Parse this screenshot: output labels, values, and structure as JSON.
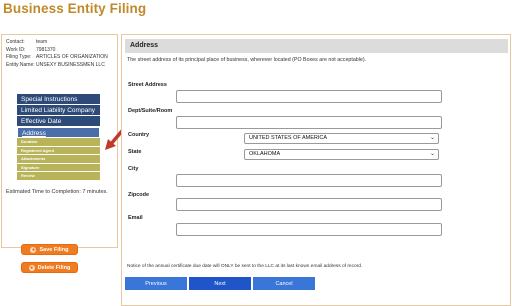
{
  "page": {
    "title": "Business Entity Filing"
  },
  "info": [
    {
      "label": "Contact:",
      "value": "team"
    },
    {
      "label": "Work ID:",
      "value": "7981370"
    },
    {
      "label": "Filing Type:",
      "value": "ARTICLES OF ORGANIZATION"
    },
    {
      "label": "Entity Name:",
      "value": "UNSEXY BUSINESSMEN LLC"
    }
  ],
  "nav": {
    "items": [
      {
        "label": "Special Instructions"
      },
      {
        "label": "Limited Liability Company"
      },
      {
        "label": "Effective Date"
      },
      {
        "label": "Address"
      }
    ],
    "sub_items": [
      {
        "label": "Duration"
      },
      {
        "label": "Registered Agent"
      },
      {
        "label": "Attachments"
      },
      {
        "label": "Signature"
      },
      {
        "label": "Review"
      }
    ]
  },
  "estimate": {
    "text": "Estimated Time to Completion: 7 minutes."
  },
  "actions": {
    "save_label": "Save Filing",
    "delete_label": "Delete Filing"
  },
  "form": {
    "section_title": "Address",
    "description": "The street address of its principal place of business, wherever located (PO Boxes are not acceptable).",
    "street_label": "Street Address",
    "dept_label": "Dept/Suite/Room",
    "country_label": "Country",
    "country_value": "UNITED STATES OF AMERICA",
    "state_label": "State",
    "state_value": "OKLAHOMA",
    "city_label": "City",
    "zip_label": "Zipcode",
    "email_label": "Email",
    "notice": "Notice of the annual certificate due date will ONLY be sent to the LLC at its last known email address of record."
  },
  "footer": {
    "previous_label": "Previous",
    "next_label": "Next",
    "cancel_label": "Cancel"
  },
  "colors": {
    "title": "#c08a2a",
    "nav_primary": "#2d4a78",
    "nav_sub": "#b9b35a",
    "orange_button": "#f07c22",
    "blue_button": "#3a75d8",
    "arrow": "#c0392b"
  }
}
